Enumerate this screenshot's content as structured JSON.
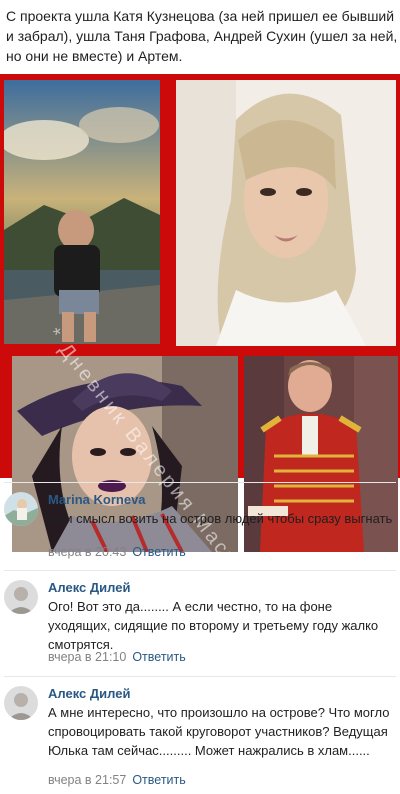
{
  "post": {
    "text": "С проекта ушла Катя Кузнецова (за ней пришел ее бывший и забрал), ушла Таня Графова, Андрей Сухин (ушел за ней, но они не вместе) и Артем."
  },
  "collage": {
    "watermark": "* Дневник Валерия Мастерко *"
  },
  "comments": [
    {
      "author": "Marina Korneva",
      "text": "ну и смысл возить на остров людей чтобы сразу выгнать",
      "time": "вчера в 20:43",
      "reply": "Ответить"
    },
    {
      "author": "Алекс Дилей",
      "text": "Ого! Вот это да........ А если честно, то на фоне уходящих, сидящие по второму и третьему году жалко смотрятся.",
      "time": "вчера в 21:10",
      "reply": "Ответить"
    },
    {
      "author": "Алекс Дилей",
      "text": "А мне интересно, что произошло на острове? Что могло спровоцировать такой круговорот участников? Ведущая Юлька там сейчас......... Может нажрались в хлам......",
      "time": "вчера в 21:57",
      "reply": "Ответить"
    }
  ]
}
